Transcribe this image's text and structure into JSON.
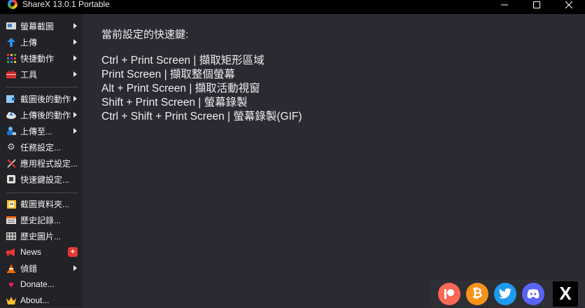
{
  "window": {
    "title": "ShareX 13.0.1 Portable",
    "minimize": "—",
    "close": "✕"
  },
  "sidebar": {
    "items": [
      {
        "label": "螢幕截圖",
        "icon": "camera-icon"
      },
      {
        "label": "上傳",
        "icon": "upload-arrow-icon"
      },
      {
        "label": "快捷動作",
        "icon": "grid-dots-icon"
      },
      {
        "label": "工具",
        "icon": "toolbox-icon"
      },
      {
        "label": "截圖後的動作",
        "icon": "image-arrow-icon"
      },
      {
        "label": "上傳後的動作",
        "icon": "cloud-upload-icon"
      },
      {
        "label": "上傳至...",
        "icon": "user-upload-icon"
      },
      {
        "label": "任務設定...",
        "icon": "gear-icon"
      },
      {
        "label": "應用程式設定...",
        "icon": "wrench-icon"
      },
      {
        "label": "快速鍵設定...",
        "icon": "keyboard-icon"
      },
      {
        "label": "截圖資料夾...",
        "icon": "folder-icon"
      },
      {
        "label": "歷史記錄...",
        "icon": "history-list-icon"
      },
      {
        "label": "歷史圖片...",
        "icon": "image-gallery-icon"
      },
      {
        "label": "News",
        "icon": "megaphone-icon",
        "badge": "+"
      },
      {
        "label": "偵錯",
        "icon": "traffic-cone-icon"
      },
      {
        "label": "Donate...",
        "icon": "heart-icon"
      },
      {
        "label": "About...",
        "icon": "crown-icon"
      }
    ]
  },
  "hotkeys": {
    "title": "當前設定的快速鍵:",
    "lines": [
      "Ctrl + Print Screen  |  擷取矩形區域",
      "Print Screen  |  擷取整個螢幕",
      "Alt + Print Screen  |  擷取活動視窗",
      "Shift + Print Screen  |  螢幕錄製",
      "Ctrl + Shift + Print Screen  |  螢幕錄製(GIF)"
    ]
  },
  "social": {
    "patreon": "patreon-icon",
    "bitcoin": "₿",
    "twitter": "twitter-icon",
    "discord": "discord-icon",
    "x": "X"
  },
  "colors": {
    "background": "#2a2a33",
    "sidebar": "#222227",
    "titlebar": "#000000"
  }
}
